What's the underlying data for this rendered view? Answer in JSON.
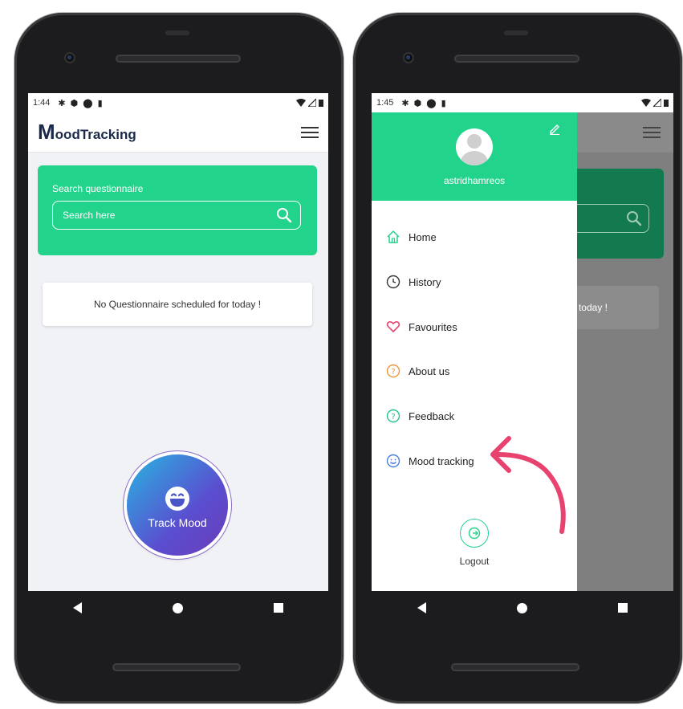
{
  "left": {
    "status": {
      "time": "1:44"
    },
    "app": {
      "logo_big": "M",
      "logo_rest": "oodTracking"
    },
    "search": {
      "label": "Search questionnaire",
      "placeholder": "Search here"
    },
    "empty_message": "No Questionnaire scheduled for today !",
    "track_button": {
      "label": "Track Mood"
    }
  },
  "right": {
    "status": {
      "time": "1:45"
    },
    "drawer": {
      "username": "astridhamreos",
      "items": [
        {
          "label": "Home",
          "icon": "home-icon"
        },
        {
          "label": "History",
          "icon": "clock-icon"
        },
        {
          "label": "Favourites",
          "icon": "heart-icon"
        },
        {
          "label": "About us",
          "icon": "question-icon"
        },
        {
          "label": "Feedback",
          "icon": "question-icon"
        },
        {
          "label": "Mood tracking",
          "icon": "smiley-icon"
        }
      ],
      "logout_label": "Logout"
    },
    "background_message": "today !"
  },
  "colors": {
    "accent": "#22d48b",
    "annotation_arrow": "#e8426f"
  }
}
